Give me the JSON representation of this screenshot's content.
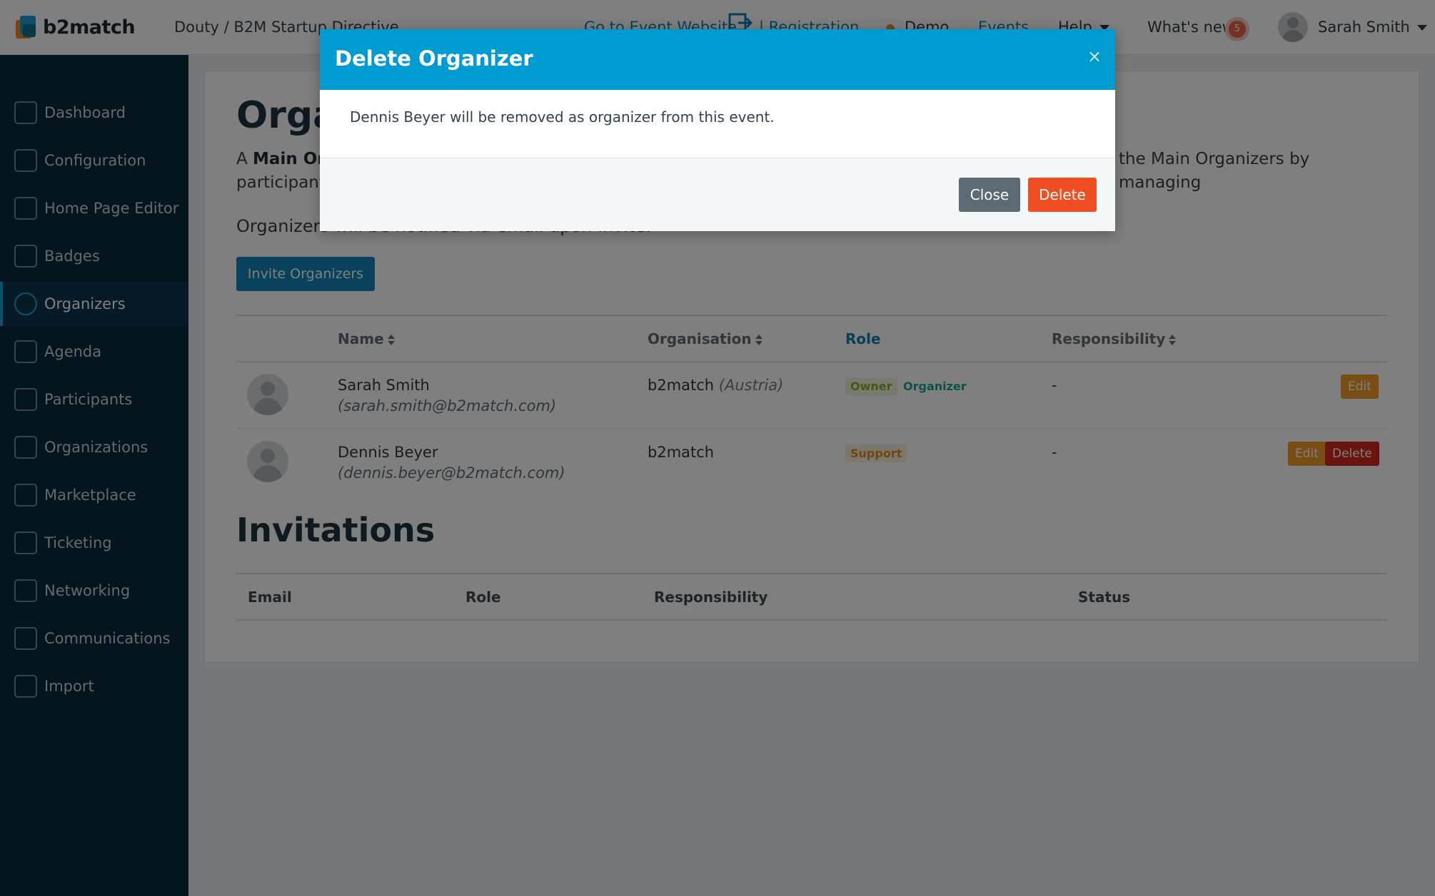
{
  "app": {
    "logo_text": "b2match",
    "event_title": "Douty / B2M Startup Directive"
  },
  "topnav": {
    "event_website": "Go to Event Website",
    "registration": "| Registration",
    "demo": "Demo",
    "events": "Events",
    "help": "Help",
    "whats_new": "What's new",
    "whats_new_count": "5",
    "user_name": "Sarah Smith"
  },
  "sidebar": {
    "items": [
      {
        "label": "Dashboard",
        "icon": "chart-icon"
      },
      {
        "label": "Configuration",
        "icon": "gear-icon"
      },
      {
        "label": "Home Page Editor",
        "icon": "document-icon"
      },
      {
        "label": "Badges",
        "icon": "sign-out-icon"
      },
      {
        "label": "Organizers",
        "icon": "users-icon",
        "active": true
      },
      {
        "label": "Agenda",
        "icon": "calendar-icon"
      },
      {
        "label": "Participants",
        "icon": "participants-icon"
      },
      {
        "label": "Organizations",
        "icon": "building-icon"
      },
      {
        "label": "Marketplace",
        "icon": "list-icon"
      },
      {
        "label": "Ticketing",
        "icon": "tag-icon"
      },
      {
        "label": "Networking",
        "icon": "handshake-icon"
      },
      {
        "label": "Communications",
        "icon": "chat-icon"
      },
      {
        "label": "Import",
        "icon": "import-icon"
      }
    ]
  },
  "main": {
    "title": "Orga",
    "intro_prefix": "A ",
    "intro_bold": "Main Or",
    "intro_rest": "the Main Organizers by managing",
    "intro_line2": "participant",
    "note": "Organizers will be notified via email upon invite.",
    "invite_button": "Invite Organizers",
    "table": {
      "headers": {
        "name": "Name",
        "organisation": "Organisation",
        "role": "Role",
        "responsibility": "Responsibility"
      },
      "rows": [
        {
          "name": "Sarah Smith",
          "email": "(sarah.smith@b2match.com)",
          "org": "b2match",
          "org_country": "(Austria)",
          "roles": [
            "Owner",
            "Organizer"
          ],
          "responsibility": "-",
          "actions": [
            "Edit"
          ]
        },
        {
          "name": "Dennis Beyer",
          "email": "(dennis.beyer@b2match.com)",
          "org": "b2match",
          "org_country": "",
          "roles": [
            "Support"
          ],
          "responsibility": "-",
          "actions": [
            "Edit",
            "Delete"
          ]
        }
      ]
    },
    "invitations": {
      "title": "Invitations",
      "headers": {
        "email": "Email",
        "role": "Role",
        "responsibility": "Responsibility",
        "status": "Status"
      }
    }
  },
  "modal": {
    "title": "Delete Organizer",
    "close_x": "×",
    "body": "Dennis Beyer will be removed as organizer from this event.",
    "close_button": "Close",
    "delete_button": "Delete"
  },
  "colors": {
    "accent": "#009bd1",
    "sidebar": "#0b2a3c",
    "danger": "#f04d23",
    "warning": "#f39c28"
  }
}
